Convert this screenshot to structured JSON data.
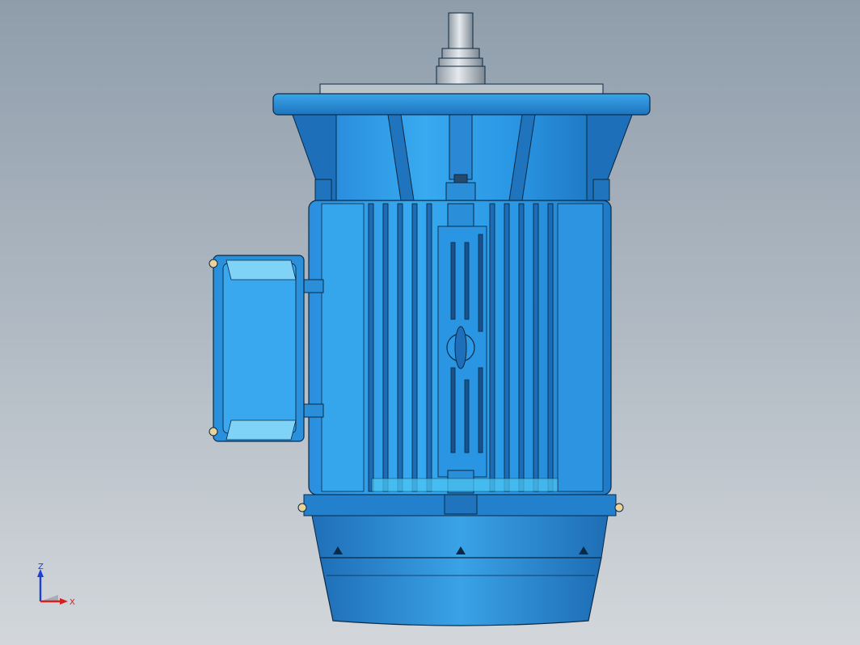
{
  "viewport": {
    "background_top": "#8f9dab",
    "background_bottom": "#d3d7db"
  },
  "model": {
    "name": "vertical-electric-motor",
    "body_color": "#2f9ee6",
    "shadow_color": "#1b6fb6",
    "outline_color": "#0a2a44",
    "shaft_color": "#c5ccd3"
  },
  "triad": {
    "z_label": "Z",
    "x_label": "X",
    "z_color": "#1c3fd6",
    "x_color": "#d62020"
  }
}
